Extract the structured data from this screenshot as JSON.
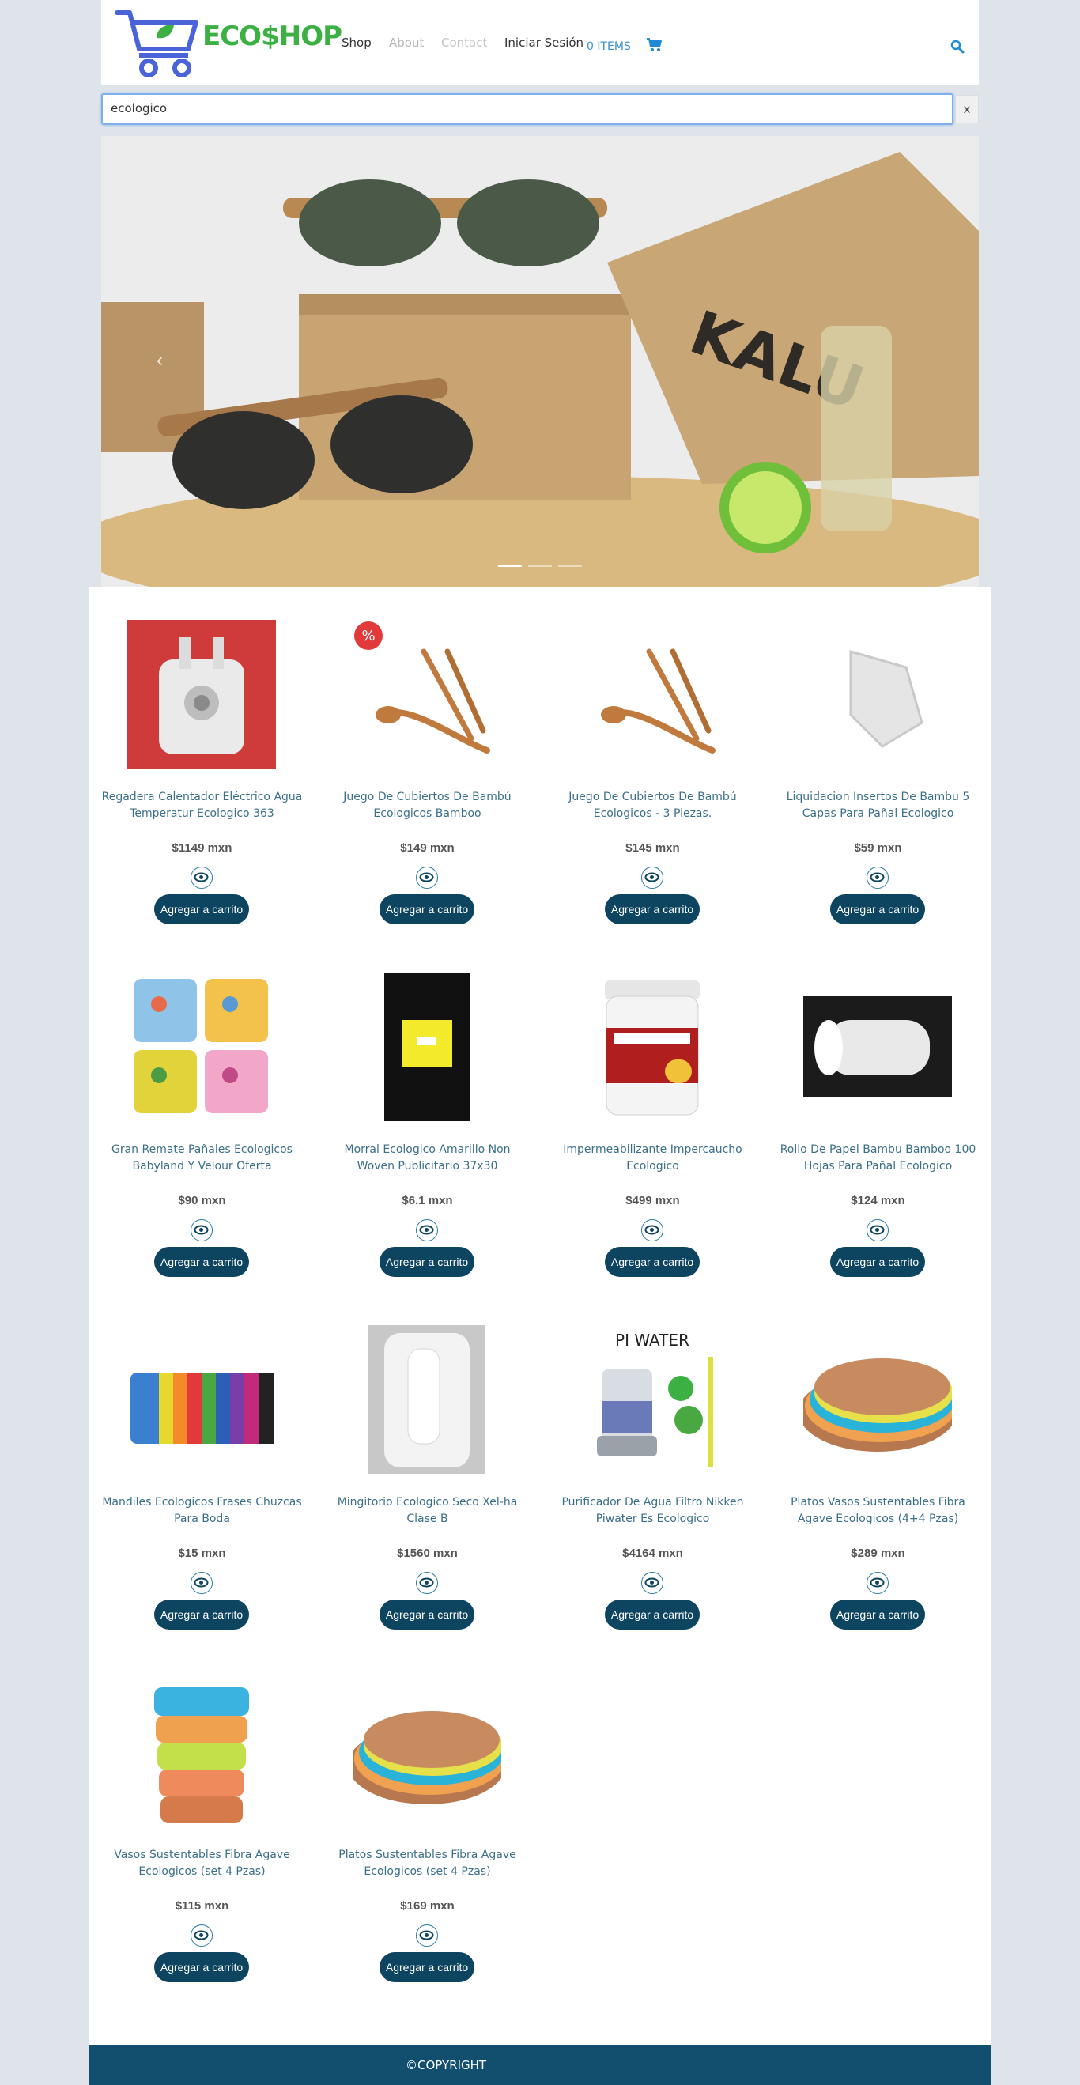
{
  "header": {
    "brand": "ECO$HOP",
    "nav": {
      "shop": "Shop",
      "about": "About",
      "contact": "Contact",
      "login": "Iniciar Sesión"
    },
    "cart_count": "0 ITEMS",
    "accent": "#3a8fd0",
    "brand_color": "#3cb043"
  },
  "search": {
    "value": "ecologico",
    "clear": "x"
  },
  "carousel": {
    "prev": "‹",
    "slides": 3,
    "active_slide": 1
  },
  "products": [
    {
      "title": "Regadera Calentador Eléctrico Agua Temperatur Ecologico 363",
      "price": "$1149 mxn",
      "image": "heater",
      "add_label": "Agregar a carrito"
    },
    {
      "title": "Juego De Cubiertos De Bambú Ecologicos Bamboo",
      "price": "$149 mxn",
      "image": "cutlery-sale",
      "add_label": "Agregar a carrito"
    },
    {
      "title": "Juego De Cubiertos De Bambú Ecologicos - 3 Piezas.",
      "price": "$145 mxn",
      "image": "cutlery",
      "add_label": "Agregar a carrito"
    },
    {
      "title": "Liquidacion Insertos De Bambu 5 Capas Para Pañal Ecologico",
      "price": "$59 mxn",
      "image": "diaper-insert",
      "add_label": "Agregar a carrito"
    },
    {
      "title": "Gran Remate Pañales Ecologicos Babyland Y Velour Oferta",
      "price": "$90 mxn",
      "image": "cloth-diapers",
      "add_label": "Agregar a carrito"
    },
    {
      "title": "Morral Ecologico Amarillo Non Woven Publicitario 37x30",
      "price": "$6.1 mxn",
      "image": "yellow-bag",
      "add_label": "Agregar a carrito"
    },
    {
      "title": "Impermeabilizante Impercaucho Ecologico",
      "price": "$499 mxn",
      "image": "bucket",
      "add_label": "Agregar a carrito"
    },
    {
      "title": "Rollo De Papel Bambu Bamboo 100 Hojas Para Pañal Ecologico",
      "price": "$124 mxn",
      "image": "paper-roll",
      "add_label": "Agregar a carrito"
    },
    {
      "title": "Mandiles Ecologicos Frases Chuzcas Para Boda",
      "price": "$15 mxn",
      "image": "aprons",
      "add_label": "Agregar a carrito"
    },
    {
      "title": "Mingitorio Ecologico Seco Xel-ha Clase B",
      "price": "$1560 mxn",
      "image": "urinal",
      "add_label": "Agregar a carrito"
    },
    {
      "title": "Purificador De Agua Filtro Nikken Piwater Es Ecologico",
      "price": "$4164 mxn",
      "image": "water-filter",
      "image_text": "PI WATER",
      "add_label": "Agregar a carrito"
    },
    {
      "title": "Platos Vasos Sustentables Fibra Agave Ecologicos (4+4 Pzas)",
      "price": "$289 mxn",
      "image": "plates",
      "add_label": "Agregar a carrito"
    },
    {
      "title": "Vasos Sustentables Fibra Agave Ecologicos (set 4 Pzas)",
      "price": "$115 mxn",
      "image": "cups",
      "add_label": "Agregar a carrito"
    },
    {
      "title": "Platos Sustentables Fibra Agave Ecologicos (set 4 Pzas)",
      "price": "$169 mxn",
      "image": "plates",
      "add_label": "Agregar a carrito"
    }
  ],
  "footer": {
    "text": "©COPYRIGHT",
    "color": "#124e6e"
  }
}
